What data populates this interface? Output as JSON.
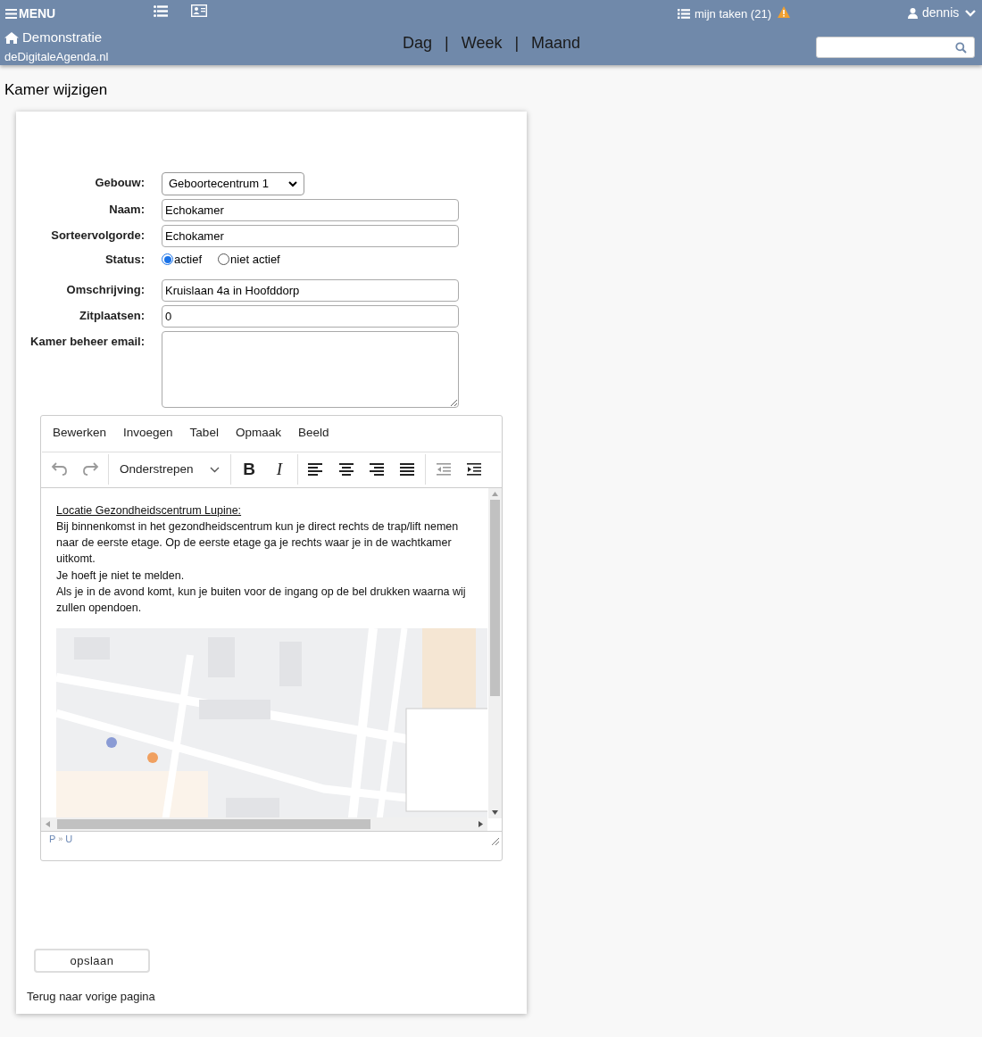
{
  "header": {
    "menu_label": "MENU",
    "brand": "Demonstratie",
    "site": "deDigitaleAgenda.nl",
    "views": [
      {
        "label": "Dag"
      },
      {
        "label": "Week"
      },
      {
        "label": "Maand"
      }
    ],
    "view_separator": "|",
    "tasks": "mijn taken (21)",
    "tasks_warning": true,
    "user": "dennis"
  },
  "page_title": "Kamer wijzigen",
  "form": [
    {
      "kind": "select",
      "label": "Gebouw:",
      "value": "Geboortecentrum 1"
    },
    {
      "kind": "text",
      "label": "Naam:",
      "value": "Echokamer"
    },
    {
      "kind": "text",
      "label": "Sorteervolgorde:",
      "value": "Echokamer"
    },
    {
      "kind": "radio",
      "label": "Status:",
      "options": [
        {
          "label": "actief",
          "selected": true
        },
        {
          "label": "niet actief",
          "selected": false
        }
      ]
    },
    {
      "kind": "text",
      "label": "Omschrijving:",
      "value": "Kruislaan 4a in Hoofddorp"
    },
    {
      "kind": "text",
      "label": "Zitplaatsen:",
      "value": "0"
    },
    {
      "kind": "textarea",
      "label": "Kamer beheer email:"
    }
  ],
  "editor": {
    "menu": [
      "Bewerken",
      "Invoegen",
      "Tabel",
      "Opmaak",
      "Beeld"
    ],
    "toolbar": [
      {
        "kind": "undo",
        "disabled": true
      },
      {
        "kind": "redo",
        "disabled": true
      },
      {
        "kind": "format",
        "label": "Onderstrepen"
      },
      {
        "kind": "bold",
        "char": "B",
        "disabled": false
      },
      {
        "kind": "italic",
        "char": "I",
        "disabled": false
      },
      {
        "kind": "align-left",
        "disabled": false
      },
      {
        "kind": "align-center",
        "disabled": false
      },
      {
        "kind": "align-right",
        "disabled": false
      },
      {
        "kind": "justify",
        "disabled": false
      },
      {
        "kind": "outdent",
        "disabled": true
      },
      {
        "kind": "indent",
        "disabled": false
      }
    ],
    "content": [
      {
        "text": "Locatie Gezondheidscentrum Lupine:",
        "underlined": true
      },
      {
        "text": "Bij binnenkomst in het gezondheidscentrum kun je direct rechts de trap/lift nemen naar de eerste etage. Op de eerste etage ga je rechts waar je in de wachtkamer uitkomt.",
        "underlined": false
      },
      {
        "text": "Je hoeft je niet te melden.",
        "underlined": false
      },
      {
        "text": "Als je in de avond komt, kun je buiten voor de ingang op de bel drukken waarna wij zullen opendoen.",
        "underlined": false
      }
    ],
    "content_picture": {
      "kind": "picture"
    },
    "path": [
      "P",
      "U"
    ],
    "path_separator": "»"
  },
  "save_button": "opslaan",
  "back_link": "Terug naar vorige pagina"
}
